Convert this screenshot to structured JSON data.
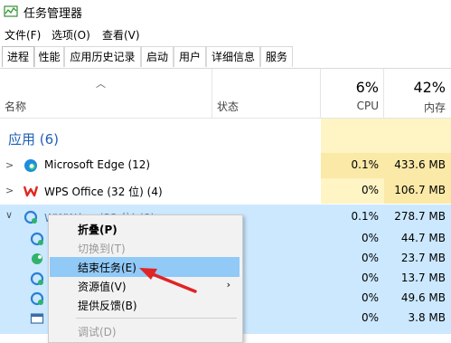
{
  "window": {
    "title": "任务管理器"
  },
  "menu": [
    "文件(F)",
    "选项(O)",
    "查看(V)"
  ],
  "tabs": [
    {
      "label": "进程",
      "active": true
    },
    {
      "label": "性能"
    },
    {
      "label": "应用历史记录"
    },
    {
      "label": "启动"
    },
    {
      "label": "用户"
    },
    {
      "label": "详细信息"
    },
    {
      "label": "服务"
    }
  ],
  "header": {
    "name": "名称",
    "status": "状态",
    "cpu_percent": "6%",
    "cpu_label": "CPU",
    "mem_percent": "42%",
    "mem_label": "内存"
  },
  "group": {
    "label": "应用 (6)"
  },
  "rows": [
    {
      "name": "Microsoft Edge (12)",
      "cpu": "0.1%",
      "mem": "433.6 MB",
      "icon": "edge-icon"
    },
    {
      "name": "WPS Office (32 位) (4)",
      "cpu": "0%",
      "mem": "106.7 MB",
      "icon": "wps-icon"
    },
    {
      "name": "WWW.h... (32 位) (8)",
      "cpu": "0.1%",
      "mem": "278.7 MB",
      "icon": "app-icon"
    }
  ],
  "subrows": [
    {
      "cpu": "0%",
      "mem": "44.7 MB",
      "icon": "app-icon"
    },
    {
      "cpu": "0%",
      "mem": "23.7 MB",
      "icon": "app-green-icon"
    },
    {
      "cpu": "0%",
      "mem": "13.7 MB",
      "icon": "app-icon"
    },
    {
      "cpu": "0%",
      "mem": "49.6 MB",
      "icon": "app-icon"
    },
    {
      "cpu": "0%",
      "mem": "3.8 MB",
      "icon": "window-icon"
    }
  ],
  "context_menu": [
    {
      "label": "折叠(P)",
      "bold": true
    },
    {
      "label": "切换到(T)",
      "disabled": true
    },
    {
      "label": "结束任务(E)",
      "highlighted": true
    },
    {
      "label": "资源值(V)",
      "submenu": true
    },
    {
      "label": "提供反馈(B)"
    },
    {
      "label": "调试(D)",
      "disabled": true
    }
  ],
  "colors": {
    "cpu_bg": "#fff4c4",
    "cpu_bg_strong": "#fbe9a8",
    "mem_bg": "#fbe9a8",
    "selected_row": "#cce8ff",
    "highlight": "#91c9f7",
    "arrow": "#e02424"
  }
}
